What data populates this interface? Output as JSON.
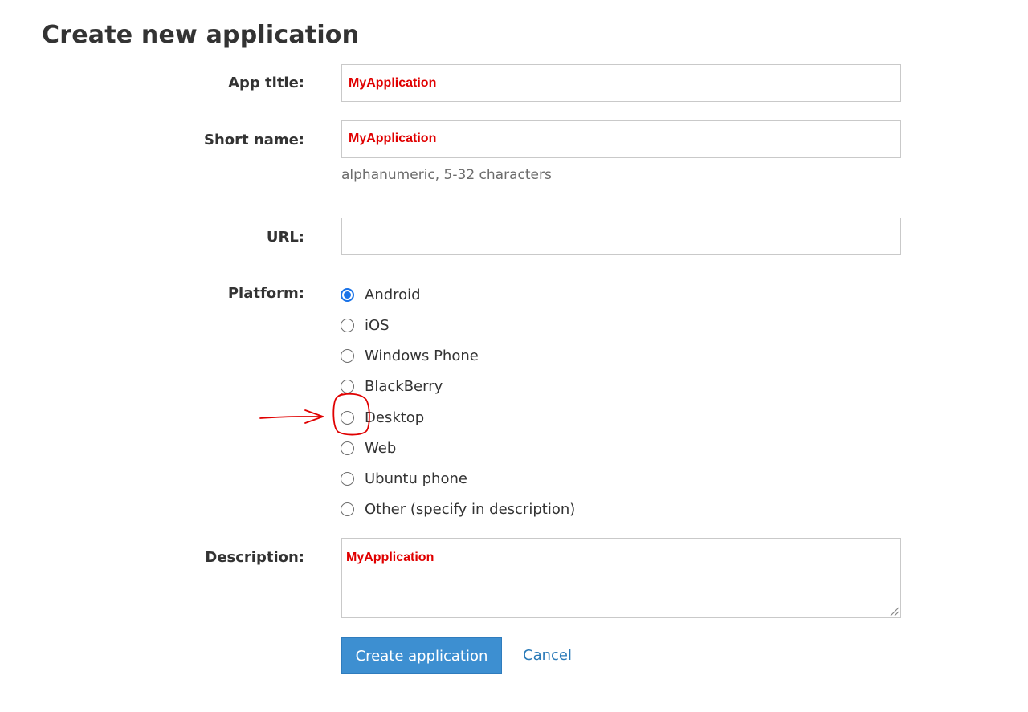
{
  "page": {
    "title": "Create new application"
  },
  "form": {
    "app_title": {
      "label": "App title:",
      "value": "MyApplication"
    },
    "short_name": {
      "label": "Short name:",
      "value": "MyApplication",
      "hint": "alphanumeric, 5-32 characters"
    },
    "url": {
      "label": "URL:",
      "value": ""
    },
    "platform": {
      "label": "Platform:",
      "selected": "Android",
      "options": [
        {
          "label": "Android",
          "checked": true
        },
        {
          "label": "iOS",
          "checked": false
        },
        {
          "label": "Windows Phone",
          "checked": false
        },
        {
          "label": "BlackBerry",
          "checked": false
        },
        {
          "label": "Desktop",
          "checked": false
        },
        {
          "label": "Web",
          "checked": false
        },
        {
          "label": "Ubuntu phone",
          "checked": false
        },
        {
          "label": "Other (specify in description)",
          "checked": false
        }
      ]
    },
    "description": {
      "label": "Description:",
      "value": "MyApplication"
    }
  },
  "actions": {
    "create_label": "Create application",
    "cancel_label": "Cancel"
  },
  "colors": {
    "accent": "#3d8fd1",
    "link": "#2a7ab8",
    "radio_selected": "#1a73e8",
    "annotation_red": "#e00000"
  }
}
